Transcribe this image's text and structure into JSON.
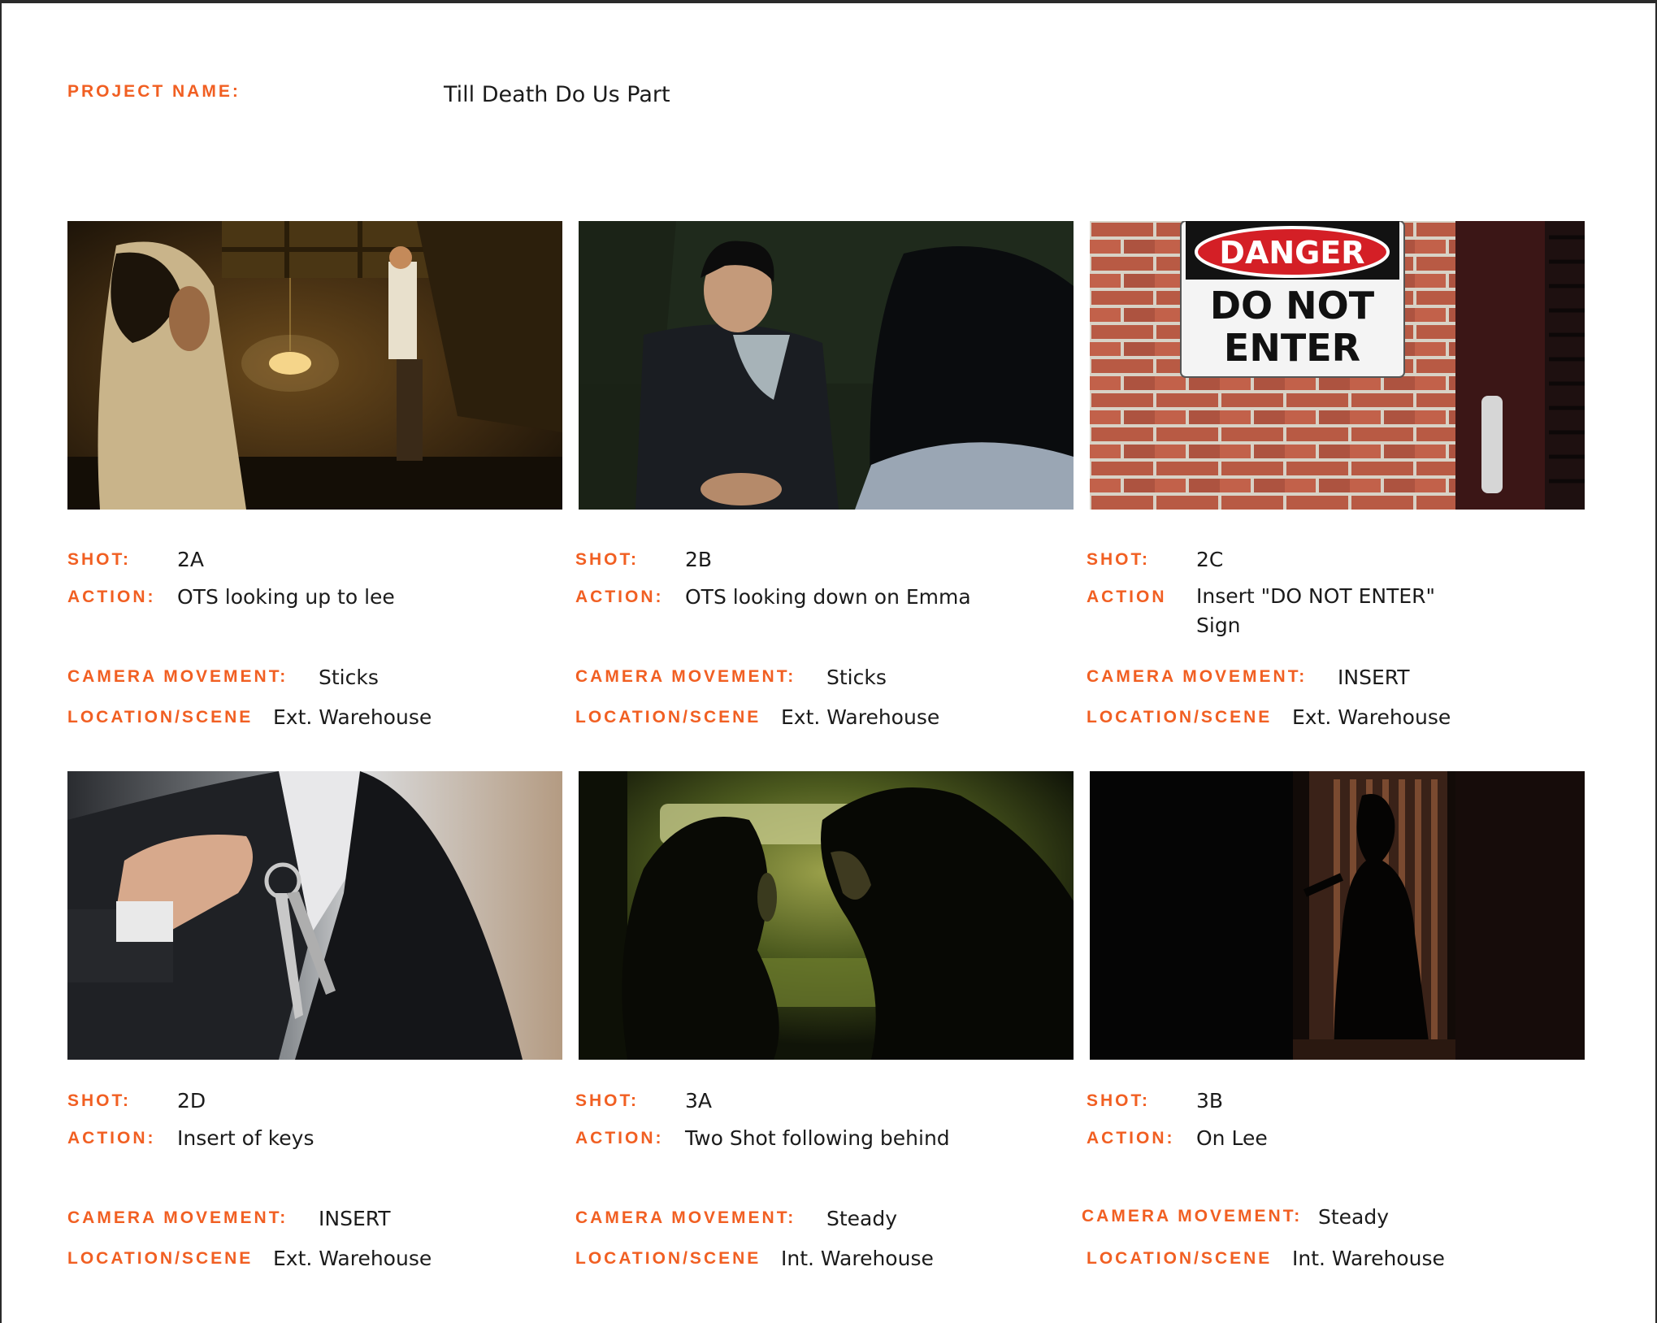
{
  "project": {
    "label": "PROJECT NAME:",
    "name": "Till Death Do Us Part"
  },
  "labels": {
    "shot": "SHOT:",
    "action_colon": "ACTION:",
    "action_plain": "ACTION",
    "camera_movement": "CAMERA MOVEMENT:",
    "location_scene": "LOCATION/SCENE"
  },
  "sign": {
    "danger": "DANGER",
    "line1": "DO NOT",
    "line2": "ENTER"
  },
  "shots": [
    {
      "shot": "2A",
      "action": "OTS looking up to lee",
      "camera_movement": "Sticks",
      "location": "Ext. Warehouse"
    },
    {
      "shot": "2B",
      "action": "OTS looking down on Emma",
      "camera_movement": "Sticks",
      "location": "Ext. Warehouse"
    },
    {
      "shot": "2C",
      "action": "Insert \"DO NOT ENTER\" Sign",
      "camera_movement": "INSERT",
      "location": "Ext. Warehouse"
    },
    {
      "shot": "2D",
      "action": "Insert of keys",
      "camera_movement": "INSERT",
      "location": "Ext. Warehouse"
    },
    {
      "shot": "3A",
      "action": "Two Shot following behind",
      "camera_movement": "Steady",
      "location": "Int. Warehouse"
    },
    {
      "shot": "3B",
      "action": "On Lee",
      "camera_movement": "Steady",
      "location": "Int. Warehouse"
    }
  ]
}
